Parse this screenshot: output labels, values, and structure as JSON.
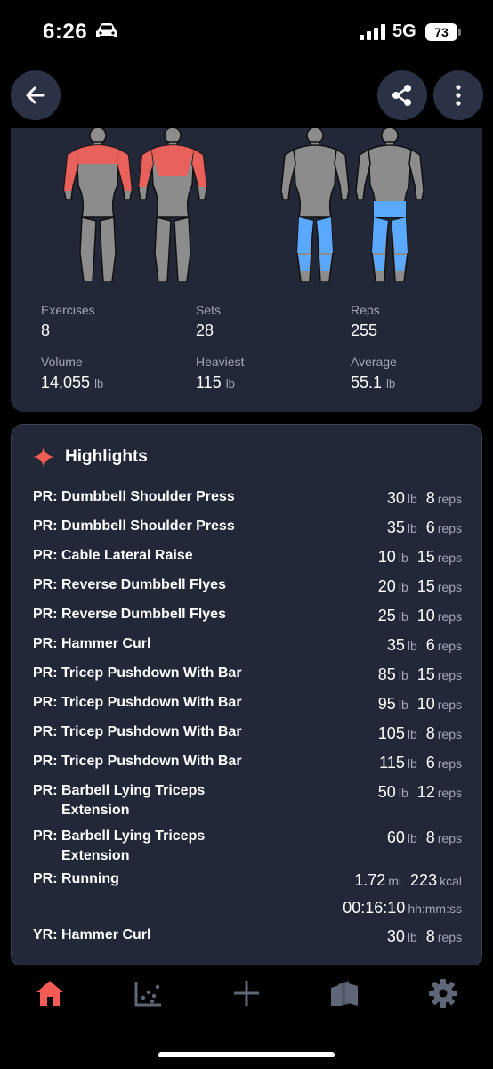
{
  "status_bar": {
    "time": "6:26",
    "network": "5G",
    "battery": "73"
  },
  "header": {
    "back_icon": "arrow-left-icon",
    "share_icon": "share-icon",
    "more_icon": "vertical-dots-icon"
  },
  "muscle_map": {
    "upper_body_highlight_color": "#f25c54",
    "lower_body_highlight_color": "#5aa8ff",
    "base_color": "#8c8c8c"
  },
  "summary": {
    "stats": [
      {
        "label": "Exercises",
        "value": "8",
        "unit": ""
      },
      {
        "label": "Sets",
        "value": "28",
        "unit": ""
      },
      {
        "label": "Reps",
        "value": "255",
        "unit": ""
      },
      {
        "label": "Volume",
        "value": "14,055",
        "unit": "lb"
      },
      {
        "label": "Heaviest",
        "value": "115",
        "unit": "lb"
      },
      {
        "label": "Average",
        "value": "55.1",
        "unit": "lb"
      }
    ]
  },
  "highlights": {
    "title": "Highlights",
    "icon": "sparkle-icon",
    "items": [
      {
        "name": "PR: Dumbbell Shoulder Press",
        "weight": "30",
        "weight_unit": "lb",
        "reps": "8",
        "reps_unit": "reps"
      },
      {
        "name": "PR: Dumbbell Shoulder Press",
        "weight": "35",
        "weight_unit": "lb",
        "reps": "6",
        "reps_unit": "reps"
      },
      {
        "name": "PR: Cable Lateral Raise",
        "weight": "10",
        "weight_unit": "lb",
        "reps": "15",
        "reps_unit": "reps"
      },
      {
        "name": "PR: Reverse Dumbbell Flyes",
        "weight": "20",
        "weight_unit": "lb",
        "reps": "15",
        "reps_unit": "reps"
      },
      {
        "name": "PR: Reverse Dumbbell Flyes",
        "weight": "25",
        "weight_unit": "lb",
        "reps": "10",
        "reps_unit": "reps"
      },
      {
        "name": "PR: Hammer Curl",
        "weight": "35",
        "weight_unit": "lb",
        "reps": "6",
        "reps_unit": "reps"
      },
      {
        "name": "PR: Tricep Pushdown With Bar",
        "weight": "85",
        "weight_unit": "lb",
        "reps": "15",
        "reps_unit": "reps"
      },
      {
        "name": "PR: Tricep Pushdown With Bar",
        "weight": "95",
        "weight_unit": "lb",
        "reps": "10",
        "reps_unit": "reps"
      },
      {
        "name": "PR: Tricep Pushdown With Bar",
        "weight": "105",
        "weight_unit": "lb",
        "reps": "8",
        "reps_unit": "reps"
      },
      {
        "name": "PR: Tricep Pushdown With Bar",
        "weight": "115",
        "weight_unit": "lb",
        "reps": "6",
        "reps_unit": "reps"
      },
      {
        "name": "PR: Barbell Lying Triceps Extension",
        "weight": "50",
        "weight_unit": "lb",
        "reps": "12",
        "reps_unit": "reps"
      },
      {
        "name": "PR: Barbell Lying Triceps Extension",
        "weight": "60",
        "weight_unit": "lb",
        "reps": "8",
        "reps_unit": "reps"
      }
    ],
    "running": {
      "name": "PR: Running",
      "distance": "1.72",
      "distance_unit": "mi",
      "calories": "223",
      "calories_unit": "kcal",
      "duration": "00:16:10",
      "duration_unit": "hh:mm:ss"
    },
    "year_record": {
      "name": "YR: Hammer Curl",
      "weight": "30",
      "weight_unit": "lb",
      "reps": "8",
      "reps_unit": "reps"
    }
  },
  "bottom_nav": {
    "items": [
      {
        "icon": "home-icon",
        "active": true
      },
      {
        "icon": "chart-icon",
        "active": false
      },
      {
        "icon": "plus-icon",
        "active": false
      },
      {
        "icon": "library-icon",
        "active": false
      },
      {
        "icon": "gear-icon",
        "active": false
      }
    ],
    "active_color": "#f25c54",
    "inactive_color": "#5f6678"
  }
}
